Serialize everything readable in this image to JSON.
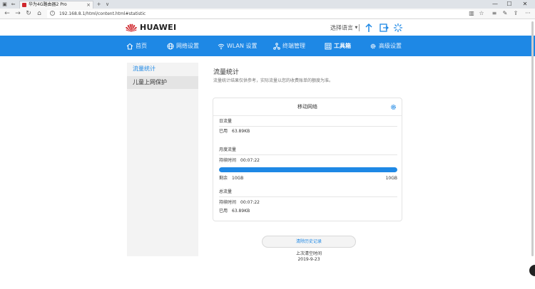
{
  "browser": {
    "tab_title": "华为4G路由器2 Pro",
    "url": "192.168.8.1/html/content.html#statistic",
    "info_glyph": "i",
    "tab_close": "×",
    "new_tab": "+",
    "tab_menu": "∨",
    "window_controls": {
      "minimize": "—",
      "maximize": "☐",
      "close": "✕"
    },
    "nav_glyphs": {
      "back": "←",
      "forward": "→",
      "refresh": "↻",
      "home": "⌂"
    },
    "tool_glyphs": {
      "reading": "▥",
      "favorite": "☆",
      "favorites_hub": "≡",
      "share": "✎",
      "notes": "⇪",
      "more": "···"
    }
  },
  "header": {
    "brand": "HUAWEI",
    "language_label": "选择语言",
    "language_caret": "▼"
  },
  "nav": {
    "items": [
      {
        "label": "首页",
        "icon": "home-icon"
      },
      {
        "label": "网络设置",
        "icon": "globe-icon"
      },
      {
        "label": "WLAN 设置",
        "icon": "wifi-icon"
      },
      {
        "label": "终端管理",
        "icon": "devices-icon"
      },
      {
        "label": "工具箱",
        "icon": "toolbox-icon",
        "active": true
      },
      {
        "label": "高级设置",
        "icon": "gear-icon"
      }
    ]
  },
  "sidebar": {
    "items": [
      {
        "label": "流量统计",
        "active": true
      },
      {
        "label": "儿童上网保护"
      }
    ]
  },
  "main": {
    "title": "流量统计",
    "description": "流量统计结果仅供参考，实际流量以您的收费账单的额度为准。",
    "card": {
      "title": "移动网络",
      "daily": {
        "label": "日流量",
        "used_label": "已用",
        "used_value": "63.89KB"
      },
      "monthly": {
        "label": "月度流量",
        "duration_label": "持续时间",
        "duration_value": "00:07:22",
        "remaining_label": "剩余",
        "remaining_value": "10GB",
        "total_value": "10GB",
        "progress_fraction": 1.0
      },
      "total": {
        "label": "总流量",
        "duration_label": "持续时间",
        "duration_value": "00:07:22",
        "used_label": "已用",
        "used_value": "63.89KB"
      }
    },
    "clear_button": "清除历史记录",
    "last_clear_label": "上次清空时间",
    "last_clear_date": "2019-9-23"
  },
  "colors": {
    "accent": "#1e88e5",
    "brand_red": "#d0282e"
  }
}
